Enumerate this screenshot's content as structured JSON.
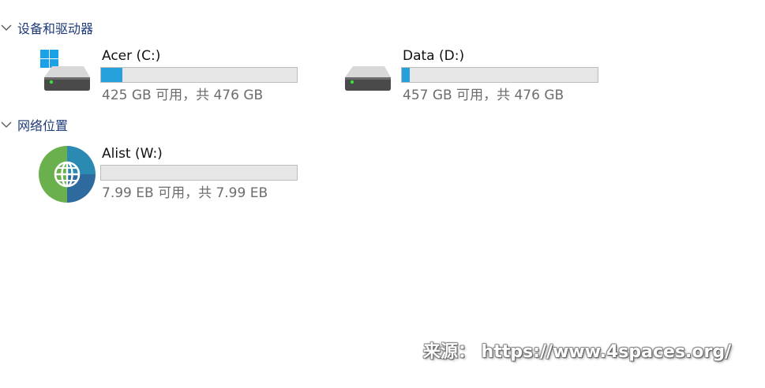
{
  "groups": [
    {
      "title": "设备和驱动器",
      "drives": [
        {
          "name": "Acer (C:)",
          "info": "425 GB 可用，共 476 GB",
          "used_fraction": 0.107,
          "icon": "windows-drive-icon"
        },
        {
          "name": "Data (D:)",
          "info": "457 GB 可用，共 476 GB",
          "used_fraction": 0.04,
          "icon": "hard-drive-icon"
        }
      ]
    },
    {
      "title": "网络位置",
      "drives": [
        {
          "name": "Alist (W:)",
          "info": "7.99 EB 可用，共 7.99 EB",
          "used_fraction": 0.0,
          "icon": "network-globe-icon"
        }
      ]
    }
  ],
  "watermark": "来源： https://www.4spaces.org/",
  "colors": {
    "bar_fill": "#26a0da",
    "group_title": "#1e3a78",
    "info_text": "#6d6d6d"
  }
}
